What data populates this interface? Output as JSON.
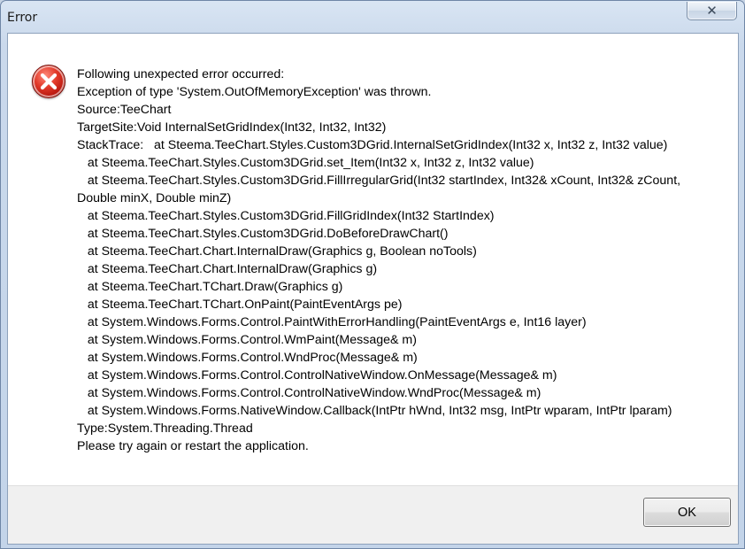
{
  "window": {
    "title": "Error",
    "close_glyph": "✕"
  },
  "dialog": {
    "icon": "error-icon",
    "message_lines": [
      "Following unexpected error occurred:",
      "Exception of type 'System.OutOfMemoryException' was thrown.",
      "Source:TeeChart",
      "TargetSite:Void InternalSetGridIndex(Int32, Int32, Int32)",
      "StackTrace:   at Steema.TeeChart.Styles.Custom3DGrid.InternalSetGridIndex(Int32 x, Int32 z, Int32 value)",
      "   at Steema.TeeChart.Styles.Custom3DGrid.set_Item(Int32 x, Int32 z, Int32 value)",
      "   at Steema.TeeChart.Styles.Custom3DGrid.FillIrregularGrid(Int32 startIndex, Int32& xCount, Int32& zCount,",
      "Double minX, Double minZ)",
      "   at Steema.TeeChart.Styles.Custom3DGrid.FillGridIndex(Int32 StartIndex)",
      "   at Steema.TeeChart.Styles.Custom3DGrid.DoBeforeDrawChart()",
      "   at Steema.TeeChart.Chart.InternalDraw(Graphics g, Boolean noTools)",
      "   at Steema.TeeChart.Chart.InternalDraw(Graphics g)",
      "   at Steema.TeeChart.TChart.Draw(Graphics g)",
      "   at Steema.TeeChart.TChart.OnPaint(PaintEventArgs pe)",
      "   at System.Windows.Forms.Control.PaintWithErrorHandling(PaintEventArgs e, Int16 layer)",
      "   at System.Windows.Forms.Control.WmPaint(Message& m)",
      "   at System.Windows.Forms.Control.WndProc(Message& m)",
      "   at System.Windows.Forms.Control.ControlNativeWindow.OnMessage(Message& m)",
      "   at System.Windows.Forms.Control.ControlNativeWindow.WndProc(Message& m)",
      "   at System.Windows.Forms.NativeWindow.Callback(IntPtr hWnd, Int32 msg, IntPtr wparam, IntPtr lparam)",
      "Type:System.Threading.Thread",
      "Please try again or restart the application."
    ]
  },
  "footer": {
    "ok_label": "OK"
  },
  "colors": {
    "error_red": "#d9281a",
    "client_bg": "#ffffff",
    "footer_bg": "#f0f0f0"
  }
}
